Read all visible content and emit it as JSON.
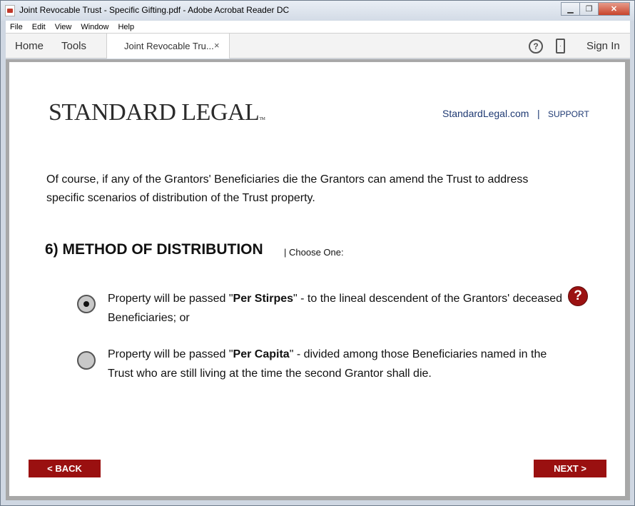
{
  "window": {
    "title": "Joint Revocable Trust - Specific Gifting.pdf - Adobe Acrobat Reader DC",
    "minimize": "▁",
    "maximize": "❐",
    "close": "✕"
  },
  "menu": [
    "File",
    "Edit",
    "View",
    "Window",
    "Help"
  ],
  "toolbar": {
    "home": "Home",
    "tools": "Tools",
    "tab_label": "Joint Revocable Tru...",
    "tab_close": "×",
    "help_icon": "?",
    "sign_in": "Sign In"
  },
  "header": {
    "logo": "STANDARD LEGAL",
    "logo_tm": "TM",
    "site_link": "StandardLegal.com",
    "separator": "|",
    "support": "SUPPORT"
  },
  "intro": "Of course, if any of the Grantors' Beneficiaries die the Grantors can amend the Trust to address specific scenarios of distribution of the Trust property.",
  "section": {
    "title": "6) METHOD OF DISTRIBUTION",
    "choose": "| Choose One:"
  },
  "options": [
    {
      "pre": "Property will be passed \"",
      "bold": "Per Stirpes",
      "post": "\" - to the lineal descendent of the Grantors' deceased Beneficiaries; or",
      "selected": true
    },
    {
      "pre": "Property will be passed \"",
      "bold": "Per Capita",
      "post": "\" - divided among those Beneficiaries named in the Trust who are still living at the time the second Grantor shall die.",
      "selected": false
    }
  ],
  "help_badge": "?",
  "nav": {
    "back": "< BACK",
    "next": "NEXT >"
  },
  "colors": {
    "accent": "#9a1010",
    "link": "#1f3a73"
  }
}
